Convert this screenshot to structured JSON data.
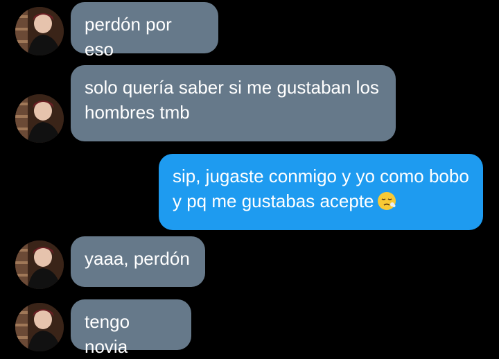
{
  "accent_colors": {
    "incoming_bubble": "#66798a",
    "outgoing_bubble": "#1e9bf0",
    "background": "#000000"
  },
  "messages": [
    {
      "direction": "incoming",
      "text": "perdón por eso",
      "avatar": "contact-avatar"
    },
    {
      "direction": "incoming",
      "text": "solo quería saber si me gustaban los hombres tmb",
      "avatar": "contact-avatar"
    },
    {
      "direction": "outgoing",
      "text": "sip, jugaste conmigo y yo como bobo y pq me gustabas acepte",
      "emoji": "sighing-face-emoji"
    },
    {
      "direction": "incoming",
      "text": "yaaa, perdón",
      "avatar": "contact-avatar"
    },
    {
      "direction": "incoming",
      "text": "tengo novia",
      "avatar": "contact-avatar"
    }
  ]
}
